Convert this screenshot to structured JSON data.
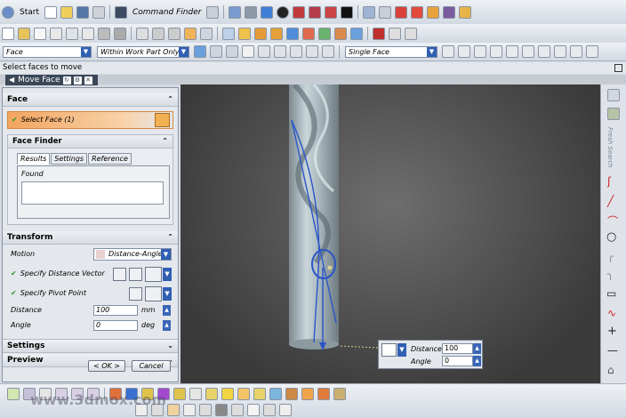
{
  "toolbar": {
    "start_label": "Start",
    "command_finder_label": "Command Finder",
    "selection_filter": "Face",
    "selection_scope": "Within Work Part Only",
    "face_rule": "Single Face"
  },
  "cue_line": "Select faces to move",
  "dialog": {
    "title": "Move Face",
    "face_section": "Face",
    "select_face_label": "Select Face (1)",
    "face_finder_label": "Face Finder",
    "tabs": [
      "Results",
      "Settings",
      "Reference"
    ],
    "found_label": "Found",
    "transform_section": "Transform",
    "motion_label": "Motion",
    "motion_value": "Distance-Angle",
    "distance_vector_label": "Specify Distance Vector",
    "pivot_point_label": "Specify Pivot Point",
    "distance_label": "Distance",
    "distance_value": "100",
    "distance_unit": "mm",
    "angle_label": "Angle",
    "angle_value": "0",
    "angle_unit": "deg",
    "settings_section": "Settings",
    "preview_section": "Preview",
    "ok_label": "< OK >",
    "cancel_label": "Cancel"
  },
  "floating_input": {
    "distance_label": "Distance",
    "distance_value": "100",
    "angle_label": "Angle",
    "angle_value": "0"
  },
  "right_bar": {
    "vertical_label": "Fresh Search"
  },
  "watermark": {
    "text": "www.3dmox.com"
  },
  "colors": {
    "accent": "#f0a050",
    "vector": "#2b55c8",
    "viewport_dark": "#3a3a3a",
    "part_surface": "#b4c1c7"
  }
}
